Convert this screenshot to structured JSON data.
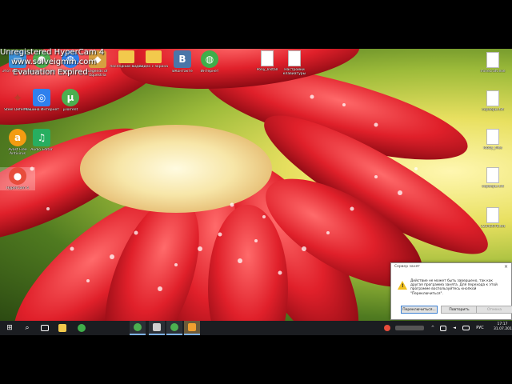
{
  "watermark": {
    "title": "Unregistered HyperCam 4",
    "site": "www.solveigmm.com",
    "expired": "Evaluation Expired"
  },
  "desktop_icons": {
    "row1": [
      {
        "label": "Этот компьютер",
        "icon": "computer-icon",
        "color": "#3a8fd8"
      },
      {
        "label": "Google Chrome",
        "icon": "chrome-icon",
        "color": "#4caf50"
      },
      {
        "label": "WebVoi ce",
        "icon": "globe-icon",
        "color": "#2f80ed"
      },
      {
        "label": "Legends of Equestria",
        "icon": "game-icon",
        "color": "#d6a040"
      },
      {
        "label": "последний видео",
        "icon": "folder-icon",
        "color": "#f2c94c"
      },
      {
        "label": "видео с экрана",
        "icon": "folder-icon",
        "color": "#f2c94c"
      },
      {
        "label": "ВКонтакте",
        "icon": "vk-icon",
        "color": "#4a76a8"
      },
      {
        "label": "Интернет",
        "icon": "globe-icon",
        "color": "#3fae4a"
      }
    ],
    "row2": [
      {
        "label": "Steel Defender",
        "icon": "stickman-icon",
        "color": "#c0392b"
      },
      {
        "label": "Машина Интернет",
        "icon": "target-icon",
        "color": "#2f80ed"
      },
      {
        "label": "µTorrent",
        "icon": "utorrent-icon",
        "color": "#4caf50"
      }
    ],
    "row3": [
      {
        "label": "Avast Free Antivirus",
        "icon": "avast-icon",
        "color": "#f39c12"
      },
      {
        "label": "Audio Editor",
        "icon": "music-icon",
        "color": "#27ae60"
      }
    ],
    "row4": [
      {
        "label": "HyperCam 4",
        "icon": "hypercam-icon",
        "color": "#e74c3c"
      }
    ],
    "center_docs": [
      {
        "label": "Pony_Install",
        "icon": "document-icon"
      },
      {
        "label": "Настройки клавиатуры",
        "icon": "document-icon"
      }
    ],
    "right_docs": [
      {
        "label": "minecraft.exe",
        "icon": "document-icon"
      },
      {
        "label": "серверы.txt",
        "icon": "document-icon"
      },
      {
        "label": "lobby_files",
        "icon": "document-icon"
      },
      {
        "label": "серверы.txt",
        "icon": "document-icon"
      },
      {
        "label": "12345678.txt",
        "icon": "document-icon"
      }
    ]
  },
  "dialog": {
    "title": "Сервер занят",
    "close_glyph": "×",
    "message": "Действие не может быть завершено, так как другая программа занята. Для перехода к этой программе воспользуйтесь кнопкой \"Переключиться\".",
    "buttons": {
      "switch": "Переключиться...",
      "retry": "Повторить",
      "cancel": "Отмена"
    }
  },
  "taskbar": {
    "start_glyph": "⊞",
    "search_glyph": "⌕",
    "language": "РУС",
    "time": "17:17",
    "date": "31.07.2016"
  }
}
